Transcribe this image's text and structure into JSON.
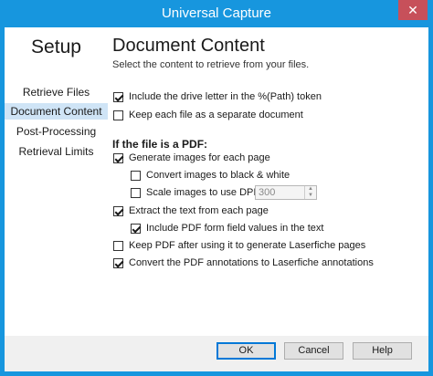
{
  "window": {
    "title": "Universal Capture",
    "close_glyph": "✕"
  },
  "sidebar": {
    "title": "Setup",
    "items": [
      {
        "label": "Retrieve Files"
      },
      {
        "label": "Document Content"
      },
      {
        "label": "Post-Processing"
      },
      {
        "label": "Retrieval Limits"
      }
    ]
  },
  "main": {
    "heading": "Document Content",
    "subtitle": "Select the content to retrieve from your files.",
    "options": {
      "drive_letter": {
        "label": "Include the drive letter in the %(Path) token",
        "checked": true
      },
      "separate_document": {
        "label": "Keep each file as a separate document",
        "checked": false
      }
    },
    "pdf_section_label": "If the file is a PDF:",
    "pdf_options": {
      "generate_images": {
        "label": "Generate images for each page",
        "checked": true
      },
      "black_white": {
        "label": "Convert images to black & white",
        "checked": false
      },
      "scale_dpi": {
        "label": "Scale images to use DPI:",
        "checked": false
      },
      "extract_text": {
        "label": "Extract the text from each page",
        "checked": true
      },
      "form_fields": {
        "label": "Include PDF form field values in the text",
        "checked": true
      },
      "keep_pdf": {
        "label": "Keep PDF after using it to generate Laserfiche pages",
        "checked": false
      },
      "annotations": {
        "label": "Convert the PDF annotations to Laserfiche annotations",
        "checked": true
      }
    },
    "dpi_value": "300"
  },
  "buttons": {
    "ok": "OK",
    "cancel": "Cancel",
    "help": "Help"
  }
}
